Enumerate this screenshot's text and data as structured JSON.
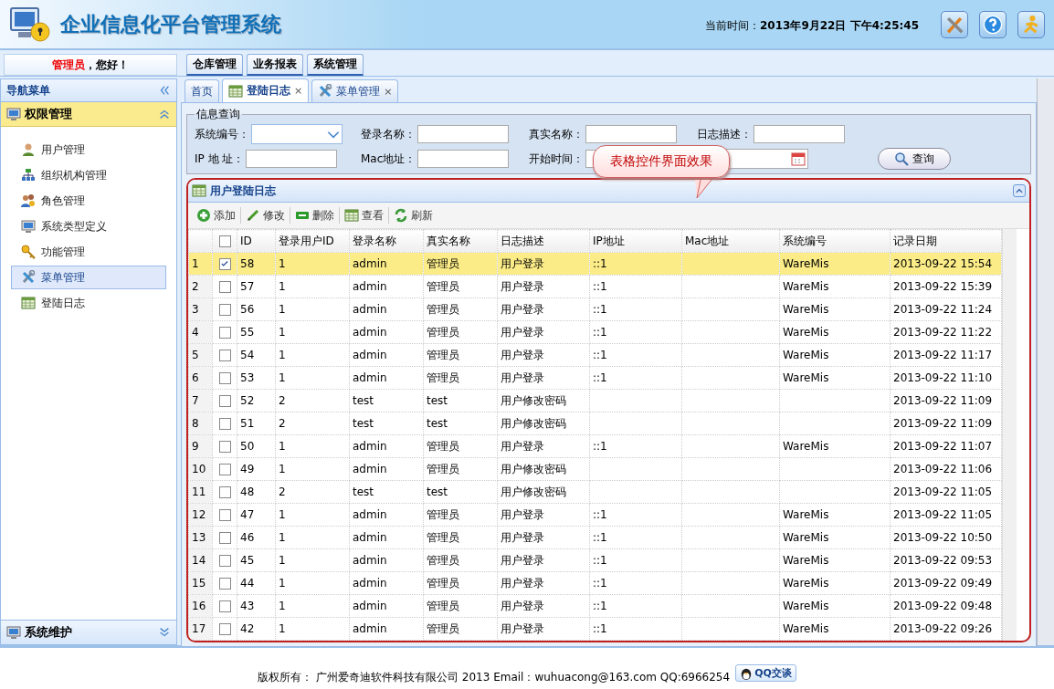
{
  "header": {
    "title": "企业信息化平台管理系统",
    "time_label": "当前时间：",
    "time_value": "2013年9月22日 下午4:25:45"
  },
  "greeting": {
    "user": "管理员",
    "text": "，您好！"
  },
  "top_tabs": [
    "仓库管理",
    "业务报表",
    "系统管理"
  ],
  "sidebar": {
    "title": "导航菜单",
    "sections": [
      {
        "title": "权限管理",
        "expanded": true,
        "items": [
          {
            "label": "用户管理",
            "selected": false
          },
          {
            "label": "组织机构管理",
            "selected": false
          },
          {
            "label": "角色管理",
            "selected": false
          },
          {
            "label": "系统类型定义",
            "selected": false
          },
          {
            "label": "功能管理",
            "selected": false
          },
          {
            "label": "菜单管理",
            "selected": true
          },
          {
            "label": "登陆日志",
            "selected": false
          }
        ]
      },
      {
        "title": "系统维护",
        "expanded": false
      }
    ]
  },
  "content_tabs": [
    {
      "label": "首页",
      "selected": false,
      "closable": false
    },
    {
      "label": "登陆日志",
      "selected": true,
      "closable": true,
      "close": "×"
    },
    {
      "label": "菜单管理",
      "selected": false,
      "closable": true,
      "close": "×"
    }
  ],
  "query": {
    "title": "信息查询",
    "search_button": "查询",
    "fields": [
      {
        "label": "系统编号：",
        "kind": "select"
      },
      {
        "label": "登录名称：",
        "kind": "text"
      },
      {
        "label": "真实名称：",
        "kind": "text"
      },
      {
        "label": "日志描述：",
        "kind": "text"
      },
      {
        "label": "IP 地 址：",
        "kind": "text"
      },
      {
        "label": "Mac地址：",
        "kind": "text"
      },
      {
        "label": "开始时间：",
        "kind": "text"
      },
      {
        "kind": "date"
      }
    ]
  },
  "callout": "表格控件界面效果",
  "grid": {
    "title": "用户登陆日志",
    "toolbar": [
      "添加",
      "修改",
      "删除",
      "查看",
      "刷新"
    ],
    "select_all_checked": false,
    "columns": [
      "ID",
      "登录用户ID",
      "登录名称",
      "真实名称",
      "日志描述",
      "IP地址",
      "Mac地址",
      "系统编号",
      "记录日期"
    ],
    "rows": [
      {
        "num": "1",
        "checked": true,
        "selected": true,
        "cells": [
          "58",
          "1",
          "admin",
          "管理员",
          "用户登录",
          "::1",
          "",
          "WareMis",
          "2013-09-22 15:54"
        ]
      },
      {
        "num": "2",
        "checked": false,
        "selected": false,
        "cells": [
          "57",
          "1",
          "admin",
          "管理员",
          "用户登录",
          "::1",
          "",
          "WareMis",
          "2013-09-22 15:39"
        ]
      },
      {
        "num": "3",
        "checked": false,
        "selected": false,
        "cells": [
          "56",
          "1",
          "admin",
          "管理员",
          "用户登录",
          "::1",
          "",
          "WareMis",
          "2013-09-22 11:24"
        ]
      },
      {
        "num": "4",
        "checked": false,
        "selected": false,
        "cells": [
          "55",
          "1",
          "admin",
          "管理员",
          "用户登录",
          "::1",
          "",
          "WareMis",
          "2013-09-22 11:22"
        ]
      },
      {
        "num": "5",
        "checked": false,
        "selected": false,
        "cells": [
          "54",
          "1",
          "admin",
          "管理员",
          "用户登录",
          "::1",
          "",
          "WareMis",
          "2013-09-22 11:17"
        ]
      },
      {
        "num": "6",
        "checked": false,
        "selected": false,
        "cells": [
          "53",
          "1",
          "admin",
          "管理员",
          "用户登录",
          "::1",
          "",
          "WareMis",
          "2013-09-22 11:10"
        ]
      },
      {
        "num": "7",
        "checked": false,
        "selected": false,
        "cells": [
          "52",
          "2",
          "test",
          "test",
          "用户修改密码",
          "",
          "",
          "",
          "2013-09-22 11:09"
        ]
      },
      {
        "num": "8",
        "checked": false,
        "selected": false,
        "cells": [
          "51",
          "2",
          "test",
          "test",
          "用户修改密码",
          "",
          "",
          "",
          "2013-09-22 11:09"
        ]
      },
      {
        "num": "9",
        "checked": false,
        "selected": false,
        "cells": [
          "50",
          "1",
          "admin",
          "管理员",
          "用户登录",
          "::1",
          "",
          "WareMis",
          "2013-09-22 11:07"
        ]
      },
      {
        "num": "10",
        "checked": false,
        "selected": false,
        "cells": [
          "49",
          "1",
          "admin",
          "管理员",
          "用户修改密码",
          "",
          "",
          "",
          "2013-09-22 11:06"
        ]
      },
      {
        "num": "11",
        "checked": false,
        "selected": false,
        "cells": [
          "48",
          "2",
          "test",
          "test",
          "用户修改密码",
          "",
          "",
          "",
          "2013-09-22 11:05"
        ]
      },
      {
        "num": "12",
        "checked": false,
        "selected": false,
        "cells": [
          "47",
          "1",
          "admin",
          "管理员",
          "用户登录",
          "::1",
          "",
          "WareMis",
          "2013-09-22 11:05"
        ]
      },
      {
        "num": "13",
        "checked": false,
        "selected": false,
        "cells": [
          "46",
          "1",
          "admin",
          "管理员",
          "用户登录",
          "::1",
          "",
          "WareMis",
          "2013-09-22 10:50"
        ]
      },
      {
        "num": "14",
        "checked": false,
        "selected": false,
        "cells": [
          "45",
          "1",
          "admin",
          "管理员",
          "用户登录",
          "::1",
          "",
          "WareMis",
          "2013-09-22 09:53"
        ]
      },
      {
        "num": "15",
        "checked": false,
        "selected": false,
        "cells": [
          "44",
          "1",
          "admin",
          "管理员",
          "用户登录",
          "::1",
          "",
          "WareMis",
          "2013-09-22 09:49"
        ]
      },
      {
        "num": "16",
        "checked": false,
        "selected": false,
        "cells": [
          "43",
          "1",
          "admin",
          "管理员",
          "用户登录",
          "::1",
          "",
          "WareMis",
          "2013-09-22 09:48"
        ]
      },
      {
        "num": "17",
        "checked": false,
        "selected": false,
        "cells": [
          "42",
          "1",
          "admin",
          "管理员",
          "用户登录",
          "::1",
          "",
          "WareMis",
          "2013-09-22 09:26"
        ]
      }
    ]
  },
  "footer": {
    "text": "版权所有： 广州爱奇迪软件科技有限公司 2013 Email：wuhuacong@163.com QQ:6966254",
    "qq_button": "QQ交谈"
  }
}
